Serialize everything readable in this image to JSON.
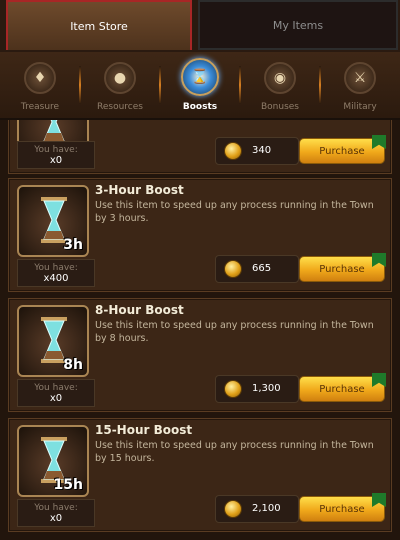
{
  "top_tabs": {
    "item_store": "Item Store",
    "my_items": "My Items"
  },
  "categories": [
    {
      "label": "Treasure",
      "icon": "treasure-icon"
    },
    {
      "label": "Resources",
      "icon": "resources-icon"
    },
    {
      "label": "Boosts",
      "icon": "boosts-icon",
      "active": true
    },
    {
      "label": "Bonuses",
      "icon": "bonuses-icon"
    },
    {
      "label": "Military",
      "icon": "military-icon"
    }
  ],
  "items": [
    {
      "title": "",
      "description": "",
      "duration_badge": "",
      "you_have_label": "You have:",
      "count": "x0",
      "price": "340",
      "purchase_label": "Purchase"
    },
    {
      "title": "3-Hour Boost",
      "description": "Use this item to speed up any process running in the Town by 3 hours.",
      "duration_badge": "3h",
      "you_have_label": "You have:",
      "count": "x400",
      "price": "665",
      "purchase_label": "Purchase"
    },
    {
      "title": "8-Hour Boost",
      "description": "Use this item to speed up any process running in the Town by 8 hours.",
      "duration_badge": "8h",
      "you_have_label": "You have:",
      "count": "x0",
      "price": "1,300",
      "purchase_label": "Purchase"
    },
    {
      "title": "15-Hour Boost",
      "description": "Use this item to speed up any process running in the Town by 15 hours.",
      "duration_badge": "15h",
      "you_have_label": "You have:",
      "count": "x0",
      "price": "2,100",
      "purchase_label": "Purchase"
    }
  ],
  "colors": {
    "accent_gold": "#f0a81a",
    "active_tab_border": "#a82626",
    "panel": "#3c2616"
  }
}
